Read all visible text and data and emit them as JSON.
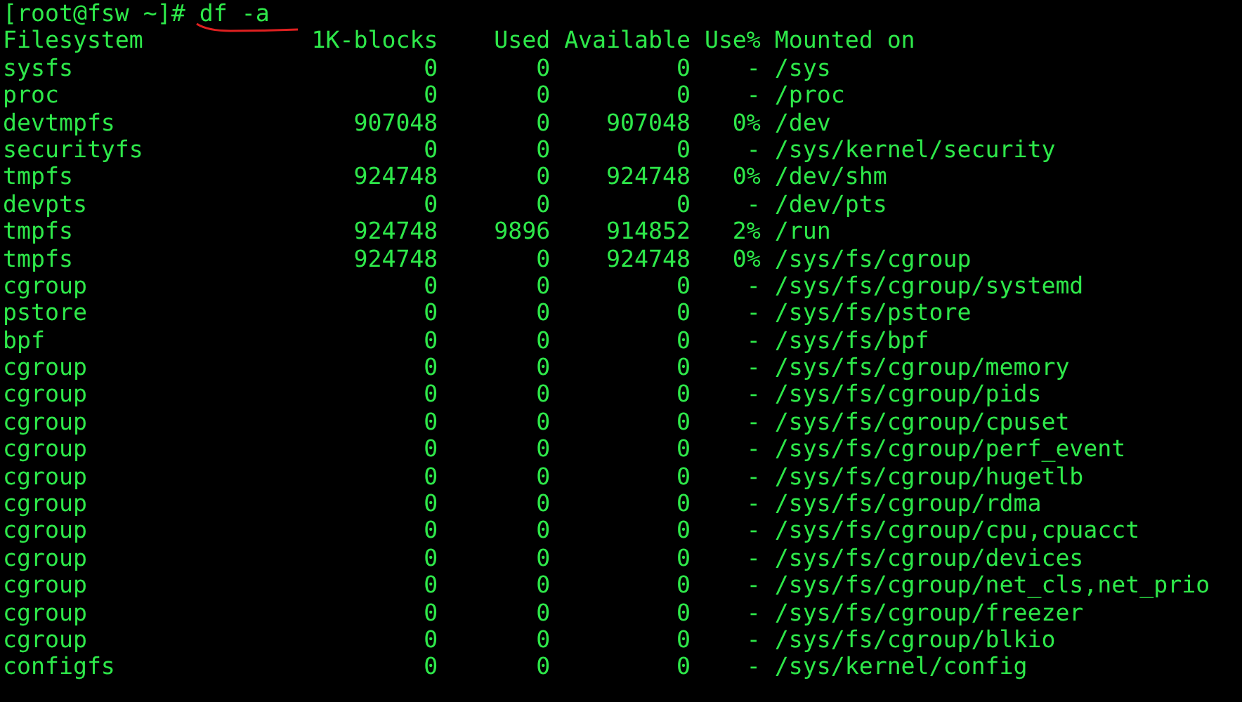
{
  "terminal": {
    "prompt": "[root@fsw ~]#",
    "command": "df -a",
    "command_underlined": true,
    "columns": [
      "Filesystem",
      "1K-blocks",
      "Used",
      "Available",
      "Use%",
      "Mounted on"
    ],
    "rows": [
      [
        "sysfs",
        "0",
        "0",
        "0",
        "-",
        "/sys"
      ],
      [
        "proc",
        "0",
        "0",
        "0",
        "-",
        "/proc"
      ],
      [
        "devtmpfs",
        "907048",
        "0",
        "907048",
        "0%",
        "/dev"
      ],
      [
        "securityfs",
        "0",
        "0",
        "0",
        "-",
        "/sys/kernel/security"
      ],
      [
        "tmpfs",
        "924748",
        "0",
        "924748",
        "0%",
        "/dev/shm"
      ],
      [
        "devpts",
        "0",
        "0",
        "0",
        "-",
        "/dev/pts"
      ],
      [
        "tmpfs",
        "924748",
        "9896",
        "914852",
        "2%",
        "/run"
      ],
      [
        "tmpfs",
        "924748",
        "0",
        "924748",
        "0%",
        "/sys/fs/cgroup"
      ],
      [
        "cgroup",
        "0",
        "0",
        "0",
        "-",
        "/sys/fs/cgroup/systemd"
      ],
      [
        "pstore",
        "0",
        "0",
        "0",
        "-",
        "/sys/fs/pstore"
      ],
      [
        "bpf",
        "0",
        "0",
        "0",
        "-",
        "/sys/fs/bpf"
      ],
      [
        "cgroup",
        "0",
        "0",
        "0",
        "-",
        "/sys/fs/cgroup/memory"
      ],
      [
        "cgroup",
        "0",
        "0",
        "0",
        "-",
        "/sys/fs/cgroup/pids"
      ],
      [
        "cgroup",
        "0",
        "0",
        "0",
        "-",
        "/sys/fs/cgroup/cpuset"
      ],
      [
        "cgroup",
        "0",
        "0",
        "0",
        "-",
        "/sys/fs/cgroup/perf_event"
      ],
      [
        "cgroup",
        "0",
        "0",
        "0",
        "-",
        "/sys/fs/cgroup/hugetlb"
      ],
      [
        "cgroup",
        "0",
        "0",
        "0",
        "-",
        "/sys/fs/cgroup/rdma"
      ],
      [
        "cgroup",
        "0",
        "0",
        "0",
        "-",
        "/sys/fs/cgroup/cpu,cpuacct"
      ],
      [
        "cgroup",
        "0",
        "0",
        "0",
        "-",
        "/sys/fs/cgroup/devices"
      ],
      [
        "cgroup",
        "0",
        "0",
        "0",
        "-",
        "/sys/fs/cgroup/net_cls,net_prio"
      ],
      [
        "cgroup",
        "0",
        "0",
        "0",
        "-",
        "/sys/fs/cgroup/freezer"
      ],
      [
        "cgroup",
        "0",
        "0",
        "0",
        "-",
        "/sys/fs/cgroup/blkio"
      ],
      [
        "configfs",
        "0",
        "0",
        "0",
        "-",
        "/sys/kernel/config"
      ]
    ]
  }
}
